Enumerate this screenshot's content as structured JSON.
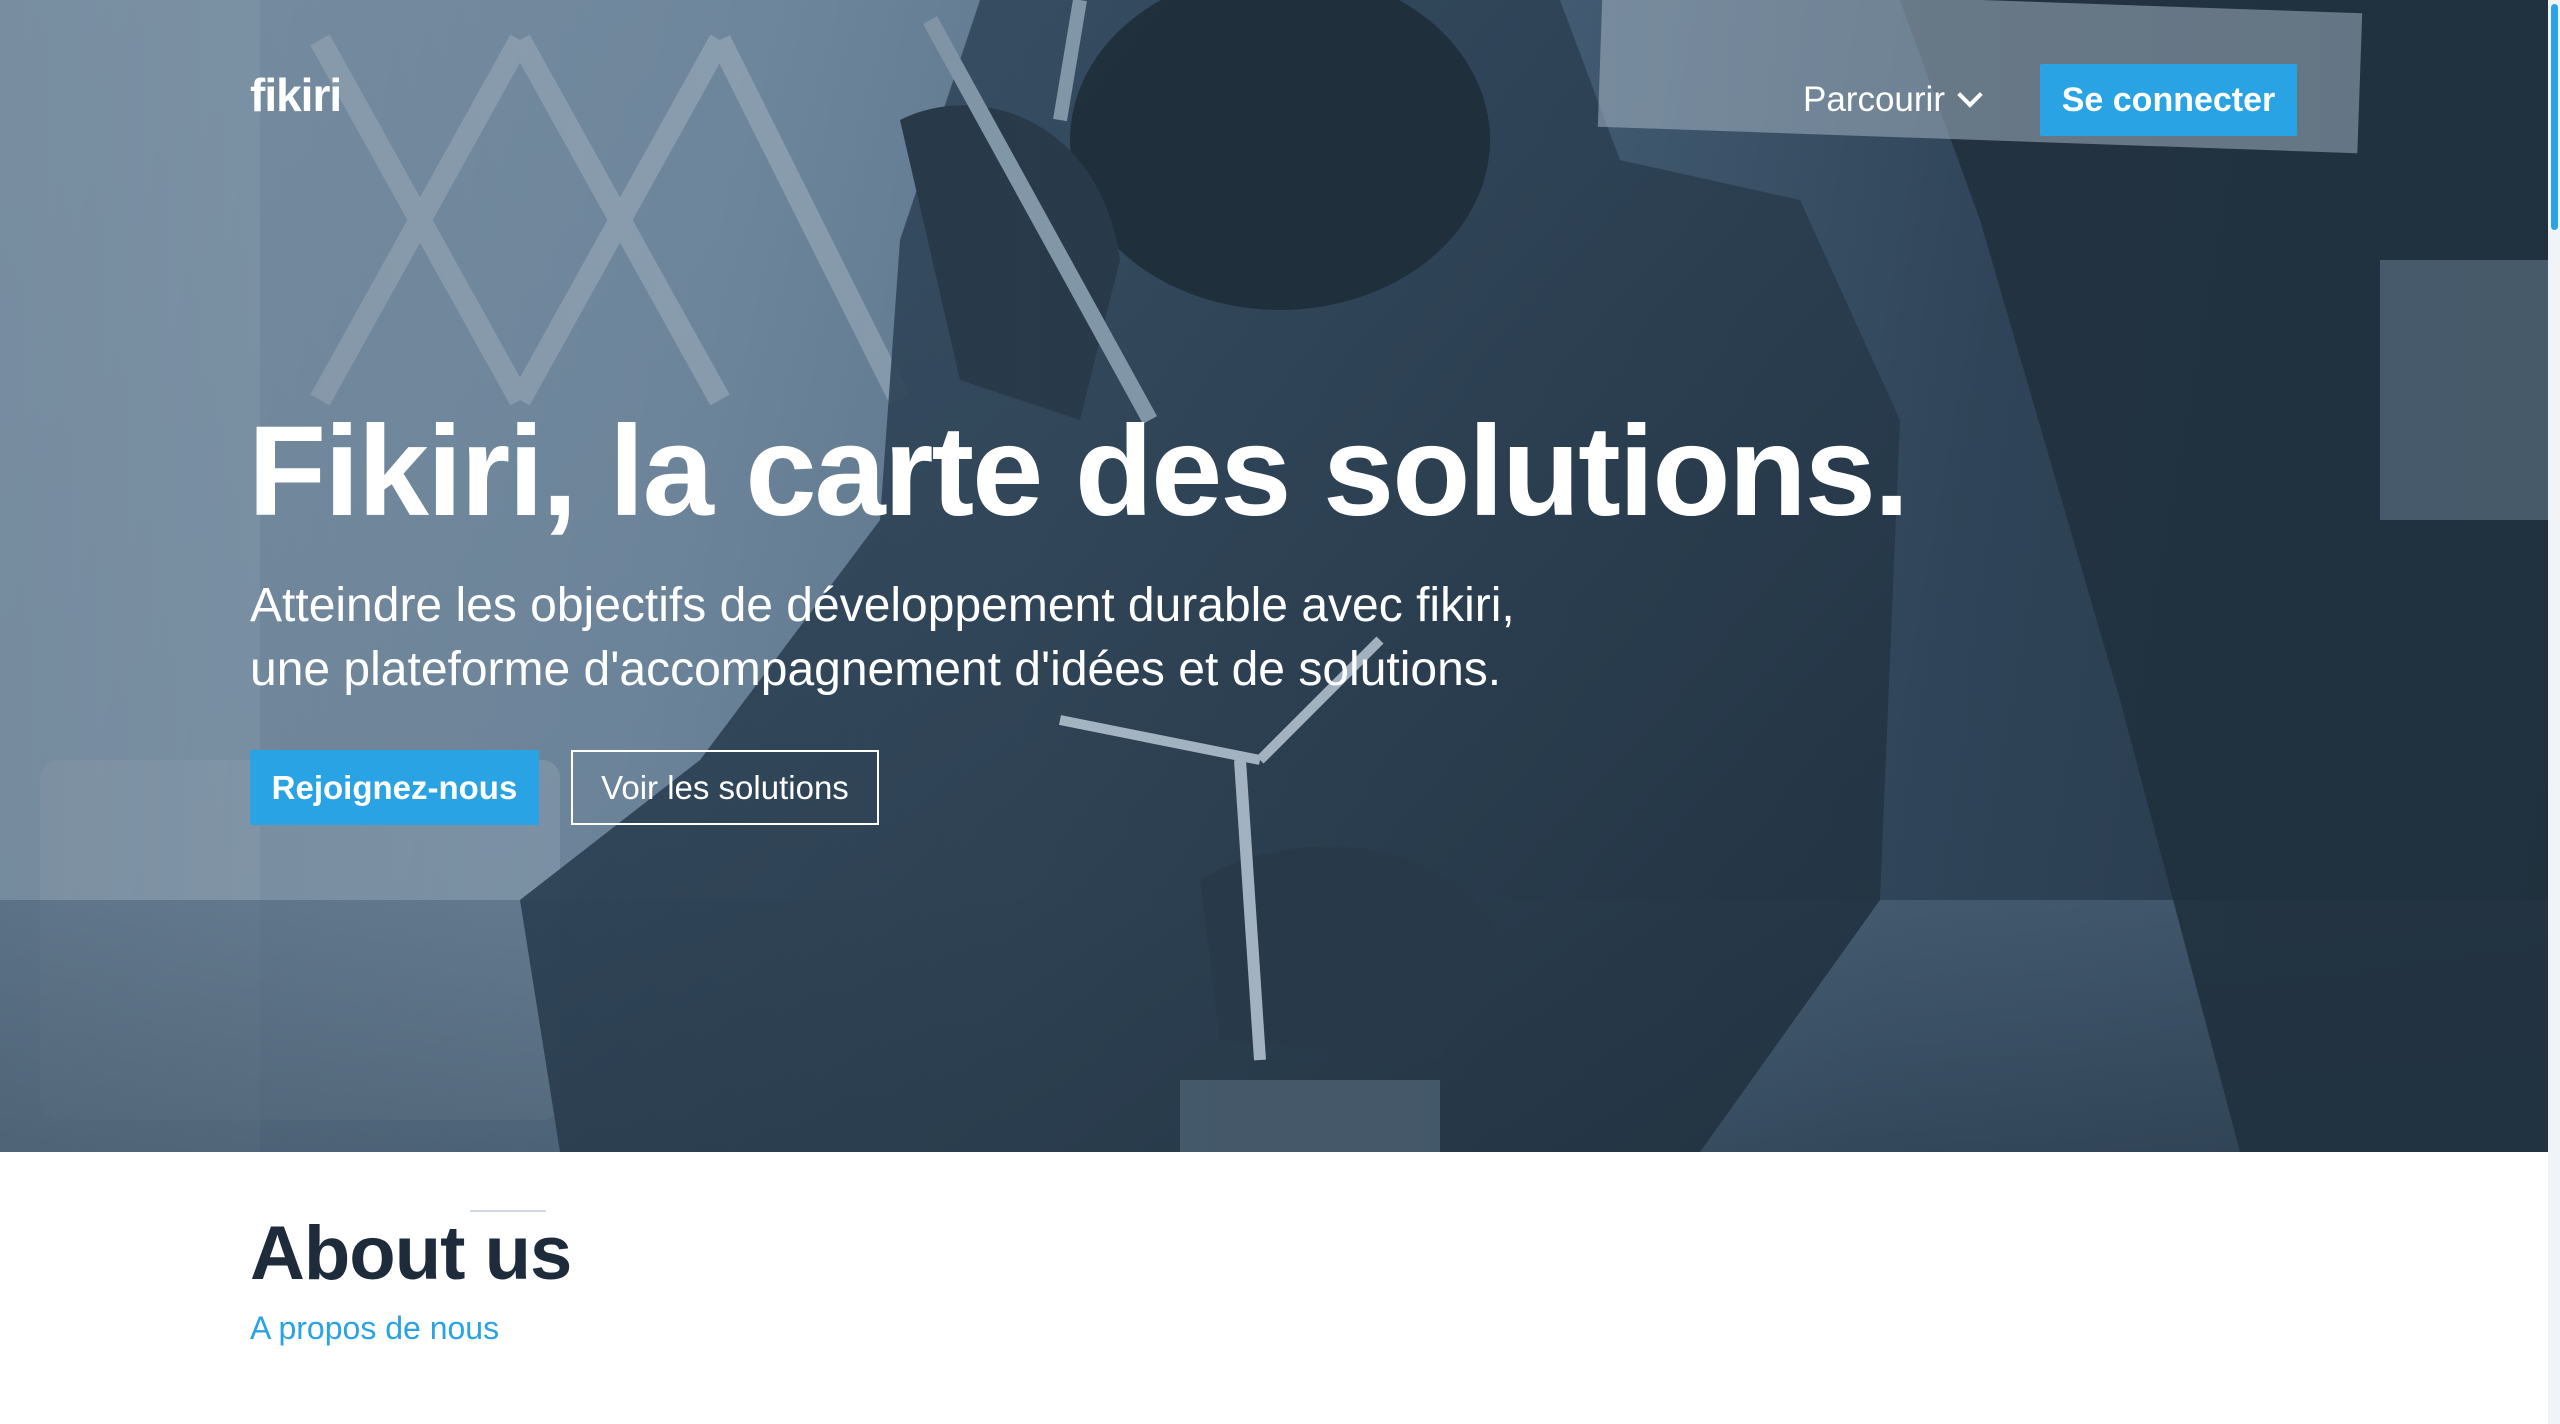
{
  "header": {
    "logo": "fikiri",
    "browse_label": "Parcourir",
    "login_label": "Se connecter"
  },
  "hero": {
    "title": "Fikiri, la carte des solutions.",
    "subtitle_lines": [
      "Atteindre les objectifs de développement durable avec fikiri,",
      "une plateforme d'accompagnement d'idées et de solutions."
    ],
    "join_label": "Rejoignez-nous",
    "solutions_label": "Voir les solutions",
    "image_description_icon": "photo-background"
  },
  "about": {
    "title": "About us",
    "subtitle": "A propos de nous"
  },
  "colors": {
    "accent": "#2aa3e4",
    "dark_text": "#1e2b3a",
    "hero_tint": "#34495d"
  },
  "icons": {
    "browse_chevron": "chevron-down-icon"
  }
}
